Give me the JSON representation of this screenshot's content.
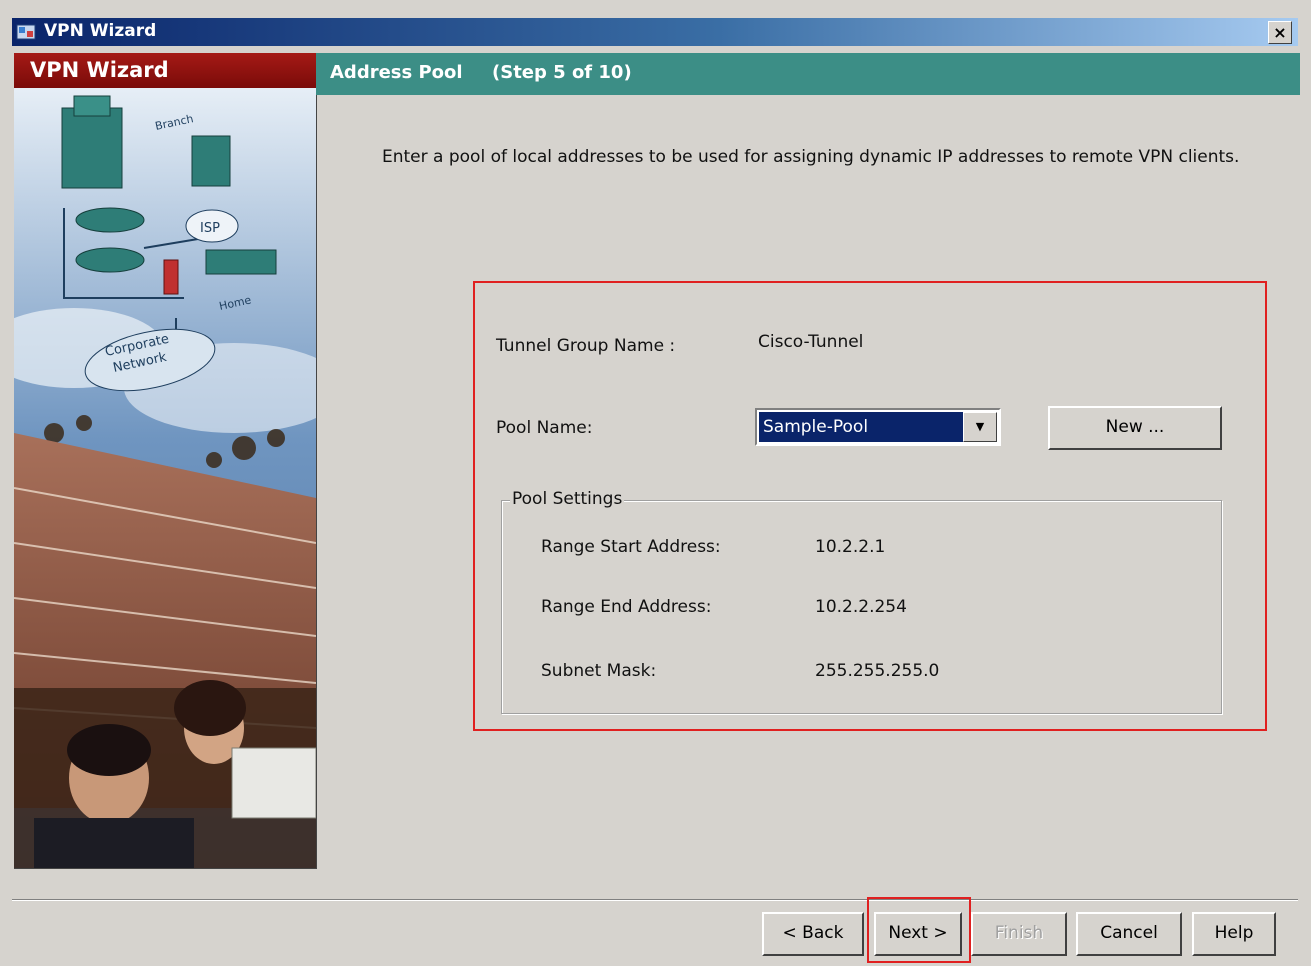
{
  "window": {
    "title": "VPN Wizard",
    "close_label": "×"
  },
  "sidebar": {
    "header": "VPN Wizard",
    "diagram_labels": {
      "branch": "Branch",
      "isp": "ISP",
      "home": "Home",
      "corporate_line1": "Corporate",
      "corporate_line2": "Network"
    }
  },
  "step": {
    "title": "Address Pool",
    "count": "(Step 5 of 10)"
  },
  "instructions": "Enter a pool of local addresses to be used for assigning dynamic IP addresses to remote VPN clients.",
  "form": {
    "tunnel_group_label": "Tunnel Group Name :",
    "tunnel_group_value": "Cisco-Tunnel",
    "pool_name_label": "Pool Name:",
    "pool_name_value": "Sample-Pool",
    "new_button": "New ...",
    "pool_settings": {
      "legend": "Pool Settings",
      "range_start_label": "Range Start Address:",
      "range_start_value": "10.2.2.1",
      "range_end_label": "Range End Address:",
      "range_end_value": "10.2.2.254",
      "subnet_mask_label": "Subnet Mask:",
      "subnet_mask_value": "255.255.255.0"
    }
  },
  "buttons": {
    "back": "< Back",
    "next": "Next >",
    "finish": "Finish",
    "cancel": "Cancel",
    "help": "Help"
  },
  "colors": {
    "title_bar": "#0a246a",
    "sidebar_header": "#a51a16",
    "step_header": "#3c8e86",
    "highlight": "#e02020",
    "selection": "#0a246a"
  }
}
